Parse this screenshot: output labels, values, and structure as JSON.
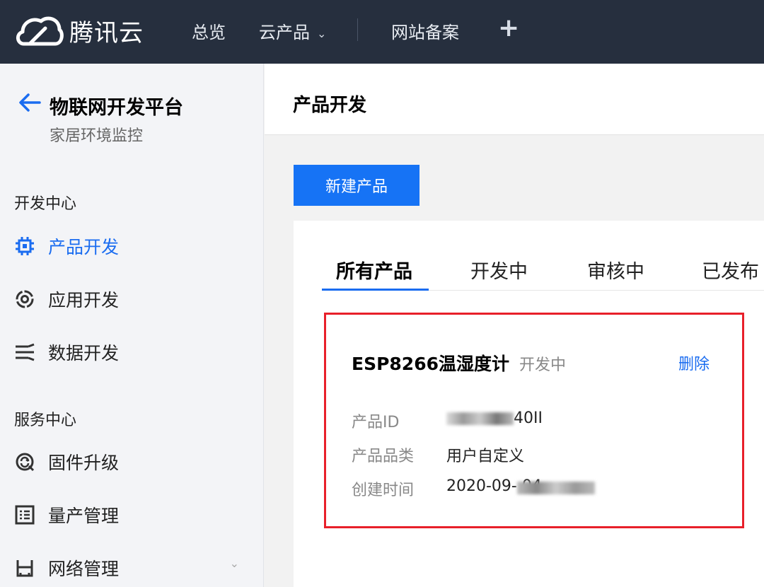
{
  "topbar": {
    "brand": "腾讯云",
    "nav": [
      "总览",
      "云产品",
      "网站备案"
    ],
    "caret": "⌄",
    "plus": "+",
    "background": "#262f3e"
  },
  "sidebar": {
    "title": "物联网开发平台",
    "subtitle": "家居环境监控",
    "section_dev": "开发中心",
    "section_service": "服务中心",
    "items": [
      {
        "label": "产品开发",
        "icon": "chip-icon",
        "active": true
      },
      {
        "label": "应用开发",
        "icon": "app-dev-icon",
        "active": false
      },
      {
        "label": "数据开发",
        "icon": "data-flow-icon",
        "active": false
      },
      {
        "label": "固件升级",
        "icon": "firmware-icon",
        "active": false
      },
      {
        "label": "量产管理",
        "icon": "list-doc-icon",
        "active": false
      },
      {
        "label": "网络管理",
        "icon": "network-icon",
        "active": false
      }
    ],
    "chevron": "⌄"
  },
  "main": {
    "title": "产品开发",
    "new_button": "新建产品",
    "tabs": [
      "所有产品",
      "开发中",
      "审核中",
      "已发布"
    ],
    "card": {
      "name": "ESP8266温湿度计",
      "status": "开发中",
      "delete": "删除",
      "fields": [
        {
          "label": "产品ID",
          "value": "40II"
        },
        {
          "label": "产品品类",
          "value": "用户自定义"
        },
        {
          "label": "创建时间",
          "value": "2020-09-  04"
        }
      ]
    }
  },
  "colors": {
    "accent": "#1a6cf0",
    "button": "#1673f5",
    "highlight_border": "#e8202a"
  }
}
